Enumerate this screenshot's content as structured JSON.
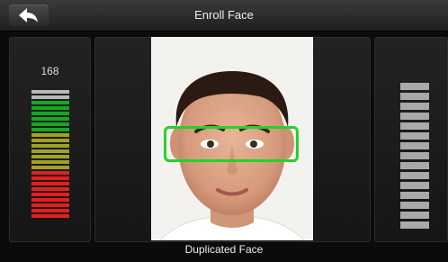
{
  "header": {
    "title": "Enroll Face",
    "back_icon": "back-arrow-icon"
  },
  "quality": {
    "score": "168"
  },
  "left_meter": {
    "colors": [
      "#b8b8b8",
      "#b8b8b8",
      "#15a820",
      "#15a820",
      "#15a820",
      "#15a820",
      "#15a820",
      "#15a820",
      "#9fa222",
      "#9fa222",
      "#9fa222",
      "#9fa222",
      "#9fa222",
      "#9fa222",
      "#9fa222",
      "#e41e1e",
      "#e41e1e",
      "#e41e1e",
      "#e41e1e",
      "#e41e1e",
      "#e41e1e",
      "#e41e1e",
      "#e41e1e",
      "#e41e1e"
    ]
  },
  "right_meter": {
    "segments": 15,
    "color": "#a9a9a9"
  },
  "detection": {
    "box_color": "#22d32b"
  },
  "status": {
    "message": "Duplicated Face"
  }
}
